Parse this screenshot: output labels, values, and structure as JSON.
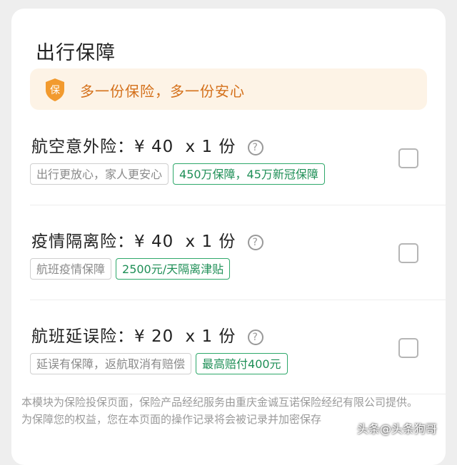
{
  "section": {
    "title": "出行保障"
  },
  "banner": {
    "icon_char": "保",
    "text": "多一份保险，多一份安心",
    "accent": "#f29a2e"
  },
  "products": [
    {
      "name": "航空意外险：",
      "price": "¥ 40",
      "quantity": "x 1 份",
      "help": "?",
      "tag_primary": "出行更放心，家人更安心",
      "tag_highlight": "450万保障，45万新冠保障",
      "checked": false
    },
    {
      "name": "疫情隔离险：",
      "price": "¥ 40",
      "quantity": "x 1 份",
      "help": "?",
      "tag_primary": "航班疫情保障",
      "tag_highlight": "2500元/天隔离津贴",
      "checked": false
    },
    {
      "name": "航班延误险：",
      "price": "¥ 20",
      "quantity": "x 1 份",
      "help": "?",
      "tag_primary": "延误有保障，返航取消有赔偿",
      "tag_highlight": "最高赔付400元",
      "checked": false
    }
  ],
  "notice": "本模块为保险投保页面，保险产品经纪服务由重庆金诚互诺保险经纪有限公司提供。为保障您的权益，您在本页面的操作记录将会被记录并加密保存",
  "watermark": "头条@头条狗哥"
}
